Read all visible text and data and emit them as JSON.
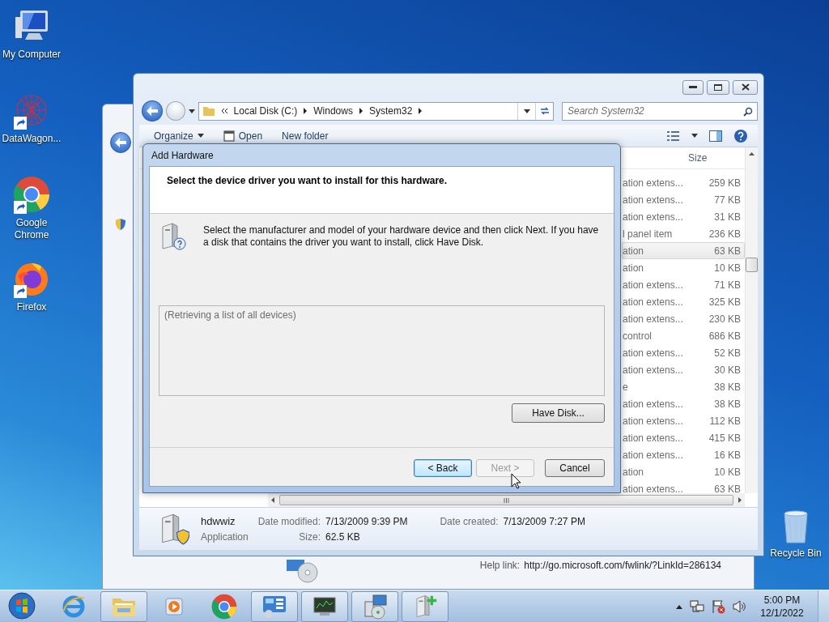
{
  "desktop_icons": [
    {
      "label": "My Computer",
      "kind": "computer",
      "shortcut": false
    },
    {
      "label": "DataWagon...",
      "kind": "network",
      "shortcut": true
    },
    {
      "label": "Google Chrome",
      "kind": "chrome",
      "shortcut": true
    },
    {
      "label": "Firefox",
      "kind": "firefox",
      "shortcut": true
    }
  ],
  "recycle_bin": {
    "label": "Recycle Bin"
  },
  "back_window": {
    "help_label": "Help link:",
    "help_url": "http://go.microsoft.com/fwlink/?LinkId=286134"
  },
  "explorer": {
    "address": [
      "Local Disk (C:)",
      "Windows",
      "System32"
    ],
    "search_placeholder": "Search System32",
    "toolbar": [
      {
        "label": "Organize",
        "kind": "menu"
      },
      {
        "label": "Open",
        "kind": "open"
      },
      {
        "label": "New folder",
        "kind": "plain"
      }
    ],
    "columns": [
      "Size"
    ],
    "rows": [
      {
        "type": "ation extens...",
        "size": "259 KB",
        "selected": false
      },
      {
        "type": "ation extens...",
        "size": "77 KB",
        "selected": false
      },
      {
        "type": "ation extens...",
        "size": "31 KB",
        "selected": false
      },
      {
        "type": "l panel item",
        "size": "236 KB",
        "selected": false
      },
      {
        "type": "ation",
        "size": "63 KB",
        "selected": true
      },
      {
        "type": "ation",
        "size": "10 KB",
        "selected": false
      },
      {
        "type": "ation extens...",
        "size": "71 KB",
        "selected": false
      },
      {
        "type": "ation extens...",
        "size": "325 KB",
        "selected": false
      },
      {
        "type": "ation extens...",
        "size": "230 KB",
        "selected": false
      },
      {
        "type": "control",
        "size": "686 KB",
        "selected": false
      },
      {
        "type": "ation extens...",
        "size": "52 KB",
        "selected": false
      },
      {
        "type": "ation extens...",
        "size": "30 KB",
        "selected": false
      },
      {
        "type": "e",
        "size": "38 KB",
        "selected": false
      },
      {
        "type": "ation extens...",
        "size": "38 KB",
        "selected": false
      },
      {
        "type": "ation extens...",
        "size": "112 KB",
        "selected": false
      },
      {
        "type": "ation extens...",
        "size": "415 KB",
        "selected": false
      },
      {
        "type": "ation extens...",
        "size": "16 KB",
        "selected": false
      },
      {
        "type": "ation",
        "size": "10 KB",
        "selected": false
      },
      {
        "type": "ation extens...",
        "size": "63 KB",
        "selected": false
      }
    ],
    "details": {
      "name": "hdwwiz",
      "type": "Application",
      "fields": [
        {
          "label": "Date modified:",
          "value": "7/13/2009 9:39 PM"
        },
        {
          "label": "Date created:",
          "value": "7/13/2009 7:27 PM"
        },
        {
          "label": "Size:",
          "value": "62.5 KB"
        }
      ]
    }
  },
  "dialog": {
    "title": "Add Hardware",
    "heading": "Select the device driver you want to install for this hardware.",
    "instructions": "Select the manufacturer and model of your hardware device and then click Next. If you have a disk that contains the driver you want to install, click Have Disk.",
    "list_placeholder": "(Retrieving a list of all devices)",
    "have_disk": "Have Disk...",
    "buttons": [
      {
        "label": "< Back",
        "default": true,
        "disabled": false
      },
      {
        "label": "Next >",
        "default": false,
        "disabled": true
      },
      {
        "label": "Cancel",
        "default": false,
        "disabled": false
      }
    ]
  },
  "taskbar": {
    "items": [
      {
        "kind": "ie",
        "open": false
      },
      {
        "kind": "explorer",
        "open": true
      },
      {
        "kind": "media",
        "open": false
      },
      {
        "kind": "chrome",
        "open": false
      },
      {
        "kind": "controlpanel",
        "open": true
      },
      {
        "kind": "monitor",
        "open": true
      },
      {
        "kind": "setup",
        "open": true
      },
      {
        "kind": "hardware",
        "open": true
      }
    ],
    "tray": [
      {
        "kind": "up"
      },
      {
        "kind": "network"
      },
      {
        "kind": "flag"
      },
      {
        "kind": "volume"
      }
    ],
    "time": "5:00 PM",
    "date": "12/1/2022"
  }
}
